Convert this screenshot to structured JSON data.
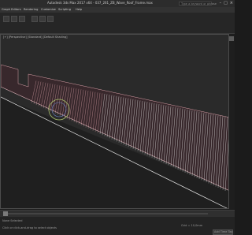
{
  "titlebar": {
    "title": "Autodesk 3ds Max 2017 x64 - 037_261_ZB_Wave_Roof_Frame.max",
    "search_placeholder": "Type a keyword or phrase",
    "minimize": "–",
    "maximize": "□",
    "close": "×"
  },
  "menubar": {
    "items": [
      "Graph Editors",
      "Rendering",
      "Customize",
      "Scripting",
      "Help"
    ]
  },
  "viewport": {
    "label": "[+] [Perspective] [Standard] [Default Shading]",
    "colors": {
      "background": "#2a2a2a",
      "wire_pink": "#d9a0a8",
      "wire_white": "#f2f2f2",
      "gizmo": "#a8c06a"
    }
  },
  "timeline": {
    "frame": "0 / 100"
  },
  "statusbar": {
    "selection": "None Selected",
    "grid": "Grid = 10,0mm",
    "hint": "Click or click-and-drag to select objects",
    "add_time_tag": "Add Time Tag"
  }
}
